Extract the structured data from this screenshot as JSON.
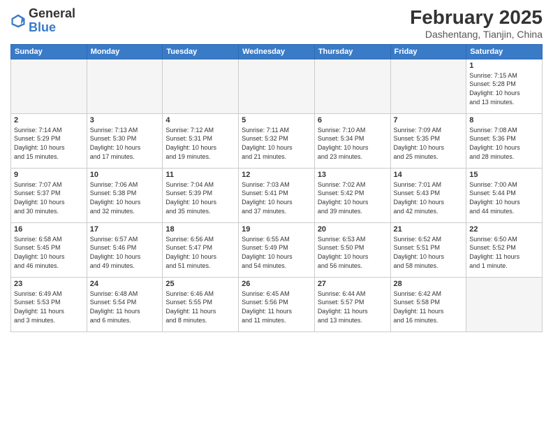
{
  "header": {
    "logo_general": "General",
    "logo_blue": "Blue",
    "month_year": "February 2025",
    "location": "Dashentang, Tianjin, China"
  },
  "days_of_week": [
    "Sunday",
    "Monday",
    "Tuesday",
    "Wednesday",
    "Thursday",
    "Friday",
    "Saturday"
  ],
  "weeks": [
    [
      {
        "day": "",
        "info": ""
      },
      {
        "day": "",
        "info": ""
      },
      {
        "day": "",
        "info": ""
      },
      {
        "day": "",
        "info": ""
      },
      {
        "day": "",
        "info": ""
      },
      {
        "day": "",
        "info": ""
      },
      {
        "day": "1",
        "info": "Sunrise: 7:15 AM\nSunset: 5:28 PM\nDaylight: 10 hours\nand 13 minutes."
      }
    ],
    [
      {
        "day": "2",
        "info": "Sunrise: 7:14 AM\nSunset: 5:29 PM\nDaylight: 10 hours\nand 15 minutes."
      },
      {
        "day": "3",
        "info": "Sunrise: 7:13 AM\nSunset: 5:30 PM\nDaylight: 10 hours\nand 17 minutes."
      },
      {
        "day": "4",
        "info": "Sunrise: 7:12 AM\nSunset: 5:31 PM\nDaylight: 10 hours\nand 19 minutes."
      },
      {
        "day": "5",
        "info": "Sunrise: 7:11 AM\nSunset: 5:32 PM\nDaylight: 10 hours\nand 21 minutes."
      },
      {
        "day": "6",
        "info": "Sunrise: 7:10 AM\nSunset: 5:34 PM\nDaylight: 10 hours\nand 23 minutes."
      },
      {
        "day": "7",
        "info": "Sunrise: 7:09 AM\nSunset: 5:35 PM\nDaylight: 10 hours\nand 25 minutes."
      },
      {
        "day": "8",
        "info": "Sunrise: 7:08 AM\nSunset: 5:36 PM\nDaylight: 10 hours\nand 28 minutes."
      }
    ],
    [
      {
        "day": "9",
        "info": "Sunrise: 7:07 AM\nSunset: 5:37 PM\nDaylight: 10 hours\nand 30 minutes."
      },
      {
        "day": "10",
        "info": "Sunrise: 7:06 AM\nSunset: 5:38 PM\nDaylight: 10 hours\nand 32 minutes."
      },
      {
        "day": "11",
        "info": "Sunrise: 7:04 AM\nSunset: 5:39 PM\nDaylight: 10 hours\nand 35 minutes."
      },
      {
        "day": "12",
        "info": "Sunrise: 7:03 AM\nSunset: 5:41 PM\nDaylight: 10 hours\nand 37 minutes."
      },
      {
        "day": "13",
        "info": "Sunrise: 7:02 AM\nSunset: 5:42 PM\nDaylight: 10 hours\nand 39 minutes."
      },
      {
        "day": "14",
        "info": "Sunrise: 7:01 AM\nSunset: 5:43 PM\nDaylight: 10 hours\nand 42 minutes."
      },
      {
        "day": "15",
        "info": "Sunrise: 7:00 AM\nSunset: 5:44 PM\nDaylight: 10 hours\nand 44 minutes."
      }
    ],
    [
      {
        "day": "16",
        "info": "Sunrise: 6:58 AM\nSunset: 5:45 PM\nDaylight: 10 hours\nand 46 minutes."
      },
      {
        "day": "17",
        "info": "Sunrise: 6:57 AM\nSunset: 5:46 PM\nDaylight: 10 hours\nand 49 minutes."
      },
      {
        "day": "18",
        "info": "Sunrise: 6:56 AM\nSunset: 5:47 PM\nDaylight: 10 hours\nand 51 minutes."
      },
      {
        "day": "19",
        "info": "Sunrise: 6:55 AM\nSunset: 5:49 PM\nDaylight: 10 hours\nand 54 minutes."
      },
      {
        "day": "20",
        "info": "Sunrise: 6:53 AM\nSunset: 5:50 PM\nDaylight: 10 hours\nand 56 minutes."
      },
      {
        "day": "21",
        "info": "Sunrise: 6:52 AM\nSunset: 5:51 PM\nDaylight: 10 hours\nand 58 minutes."
      },
      {
        "day": "22",
        "info": "Sunrise: 6:50 AM\nSunset: 5:52 PM\nDaylight: 11 hours\nand 1 minute."
      }
    ],
    [
      {
        "day": "23",
        "info": "Sunrise: 6:49 AM\nSunset: 5:53 PM\nDaylight: 11 hours\nand 3 minutes."
      },
      {
        "day": "24",
        "info": "Sunrise: 6:48 AM\nSunset: 5:54 PM\nDaylight: 11 hours\nand 6 minutes."
      },
      {
        "day": "25",
        "info": "Sunrise: 6:46 AM\nSunset: 5:55 PM\nDaylight: 11 hours\nand 8 minutes."
      },
      {
        "day": "26",
        "info": "Sunrise: 6:45 AM\nSunset: 5:56 PM\nDaylight: 11 hours\nand 11 minutes."
      },
      {
        "day": "27",
        "info": "Sunrise: 6:44 AM\nSunset: 5:57 PM\nDaylight: 11 hours\nand 13 minutes."
      },
      {
        "day": "28",
        "info": "Sunrise: 6:42 AM\nSunset: 5:58 PM\nDaylight: 11 hours\nand 16 minutes."
      },
      {
        "day": "",
        "info": ""
      }
    ]
  ]
}
